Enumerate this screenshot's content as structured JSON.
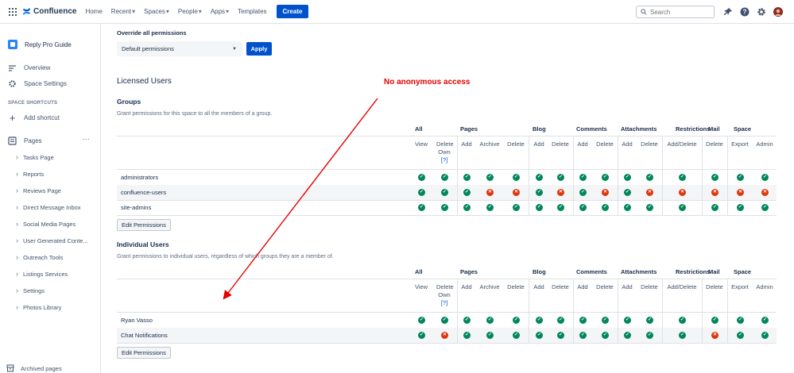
{
  "topnav": {
    "logo": "Confluence",
    "items": [
      {
        "label": "Home",
        "dropdown": false
      },
      {
        "label": "Recent",
        "dropdown": true
      },
      {
        "label": "Spaces",
        "dropdown": true
      },
      {
        "label": "People",
        "dropdown": true
      },
      {
        "label": "Apps",
        "dropdown": true
      },
      {
        "label": "Templates",
        "dropdown": false
      }
    ],
    "create": "Create",
    "search_placeholder": "Search",
    "icons": [
      "notification-icon",
      "help-icon",
      "settings-icon",
      "avatar"
    ]
  },
  "sidebar": {
    "space_name": "Reply Pro Guide",
    "overview": "Overview",
    "space_settings": "Space Settings",
    "shortcuts_heading": "SPACE SHORTCUTS",
    "add_shortcut": "Add shortcut",
    "pages": "Pages",
    "more": "···",
    "tree": [
      "Tasks Page",
      "Reports",
      "Reviews Page",
      "Direct Message Inbox",
      "Social Media Pages",
      "User Generated Conte...",
      "Outreach Tools",
      "Listings Services",
      "Settings",
      "Photos Library"
    ],
    "archived": "Archived pages"
  },
  "main": {
    "override_title": "Override all permissions",
    "select_value": "Default permissions",
    "apply": "Apply",
    "licensed_users": "Licensed Users",
    "annotation": "No anonymous access",
    "categories": [
      "All",
      "Pages",
      "Blog",
      "Comments",
      "Attachments",
      "Restrictions",
      "Mail",
      "Space"
    ],
    "columns": [
      "View",
      "Delete Own",
      "Add",
      "Archive",
      "Delete",
      "Add",
      "Delete",
      "Add",
      "Delete",
      "Add",
      "Delete",
      "Add/Delete",
      "Delete",
      "Export",
      "Admin"
    ],
    "help_mark": "[?]",
    "groups": {
      "title": "Groups",
      "description": "Grant permissions for this space to all the members of a group.",
      "rows": [
        {
          "name": "administrators",
          "perms": [
            1,
            1,
            1,
            1,
            1,
            1,
            1,
            1,
            1,
            1,
            1,
            1,
            1,
            1,
            1
          ]
        },
        {
          "name": "confluence-users",
          "perms": [
            1,
            1,
            1,
            0,
            0,
            1,
            0,
            1,
            0,
            1,
            0,
            0,
            0,
            0,
            0
          ]
        },
        {
          "name": "site-admins",
          "perms": [
            1,
            1,
            1,
            1,
            1,
            1,
            1,
            1,
            1,
            1,
            1,
            1,
            1,
            1,
            1
          ]
        }
      ],
      "edit": "Edit Permissions"
    },
    "individuals": {
      "title": "Individual Users",
      "description": "Grant permissions to individual users, regardless of which groups they are a member of.",
      "rows": [
        {
          "name": "Ryan Vasso",
          "perms": [
            1,
            1,
            1,
            1,
            1,
            1,
            1,
            1,
            1,
            1,
            1,
            1,
            1,
            1,
            1
          ]
        },
        {
          "name": "Chat Notifications",
          "perms": [
            1,
            0,
            1,
            1,
            1,
            1,
            1,
            1,
            1,
            1,
            1,
            1,
            0,
            1,
            1
          ]
        }
      ],
      "edit": "Edit Permissions"
    }
  }
}
